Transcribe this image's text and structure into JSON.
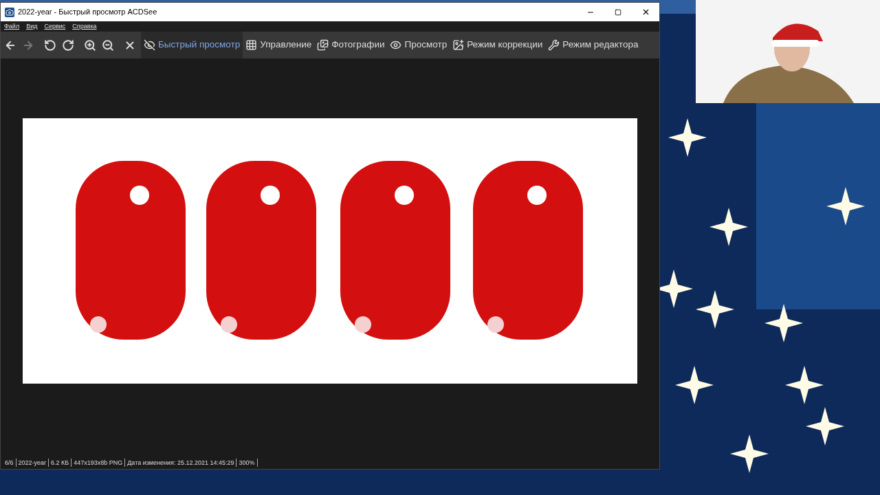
{
  "window": {
    "title": "2022-year - Быстрый просмотр ACDSee"
  },
  "menu": [
    "Файл",
    "Вид",
    "Сервис",
    "Справка"
  ],
  "modes": [
    {
      "label": "Быстрый просмотр",
      "selected": true,
      "kind": "eye-slash"
    },
    {
      "label": "Управление",
      "selected": false,
      "kind": "grid"
    },
    {
      "label": "Фотографии",
      "selected": false,
      "kind": "photos"
    },
    {
      "label": "Просмотр",
      "selected": false,
      "kind": "eye"
    },
    {
      "label": "Режим коррекции",
      "selected": false,
      "kind": "develop"
    },
    {
      "label": "Режим редактора",
      "selected": false,
      "kind": "edit"
    }
  ],
  "status_bar": [
    "6/6",
    "2022-year",
    "6.2 КБ",
    "447x193x8b PNG",
    "Дата изменения: 25.12.2021 14:45:29",
    "300%"
  ]
}
